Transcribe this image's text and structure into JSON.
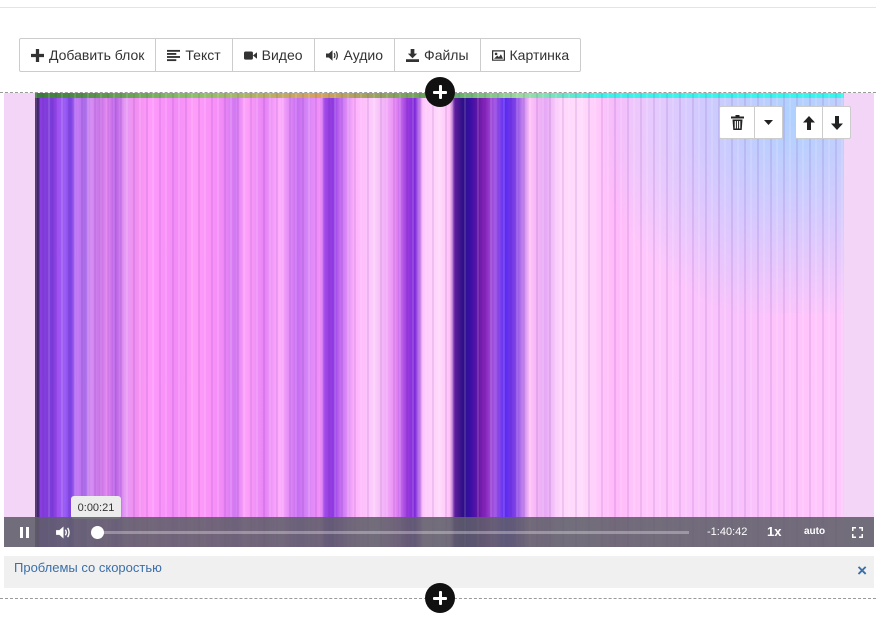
{
  "toolbar": {
    "add_block": "Добавить блок",
    "text": "Текст",
    "video": "Видео",
    "audio": "Аудио",
    "files": "Файлы",
    "image": "Картинка"
  },
  "player": {
    "tooltip_time": "0:00:21",
    "remaining_time": "-1:40:42",
    "playback_rate": "1x",
    "quality": "auto",
    "progress_fraction": 0.0035
  },
  "notice": {
    "link": "Проблемы со скоростью",
    "close": "×"
  },
  "icons": {
    "add": "plus-icon",
    "text": "align-left-icon",
    "video": "video-camera-icon",
    "audio": "volume-icon",
    "files": "download-icon",
    "image": "picture-icon",
    "delete": "trash-icon",
    "dropdown": "caret-down-icon",
    "up": "arrow-up-icon",
    "down": "arrow-down-icon",
    "pause": "pause-icon",
    "mute": "volume-icon",
    "fullscreen": "fullscreen-icon"
  },
  "colors": {
    "link": "#3b6fa8",
    "controlbar": "#5f5f69"
  }
}
